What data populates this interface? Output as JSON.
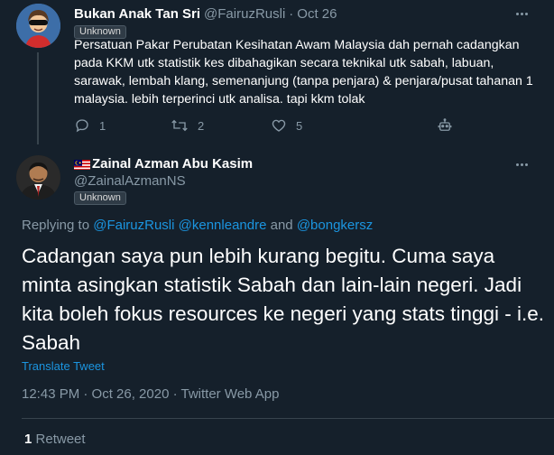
{
  "parent_tweet": {
    "name": "Bukan Anak Tan Sri",
    "handle": "@FairuzRusli",
    "separator": "·",
    "date": "Oct 26",
    "badge": "Unknown",
    "text": "Persatuan Pakar Perubatan Kesihatan Awam Malaysia dah pernah cadangkan pada KKM utk statistik kes dibahagikan secara teknikal utk sabah, labuan, sarawak, lembah klang, semenanjung (tanpa penjara) & penjara/pusat tahanan 1 malaysia. lebih terperinci utk analisa. tapi kkm tolak",
    "actions": {
      "reply_count": "1",
      "retweet_count": "2",
      "like_count": "5"
    },
    "icons": [
      "reply-icon",
      "retweet-icon",
      "like-icon",
      "robot-icon",
      "more-icon"
    ]
  },
  "focal_tweet": {
    "name": "Zainal Azman Abu Kasim",
    "handle": "@ZainalAzmanNS",
    "badge": "Unknown",
    "replying_prefix": "Replying to ",
    "replying_mentions": [
      "@FairuzRusli",
      "@kennleandre",
      "@bongkersz"
    ],
    "replying_and": " and ",
    "text": "Cadangan saya pun lebih kurang begitu.  Cuma saya minta asingkan statistik Sabah dan lain-lain negeri.  Jadi kita boleh fokus resources ke negeri yang stats tinggi - i.e. Sabah",
    "translate_label": "Translate Tweet",
    "timestamp": "12:43 PM · Oct 26, 2020 · Twitter Web App",
    "retweet_count": "1",
    "retweet_label": "Retweet"
  },
  "colors": {
    "background": "#15202b",
    "primary_text": "#ffffff",
    "secondary_text": "#8899a6",
    "link": "#1b95e0",
    "divider": "#38444d"
  }
}
